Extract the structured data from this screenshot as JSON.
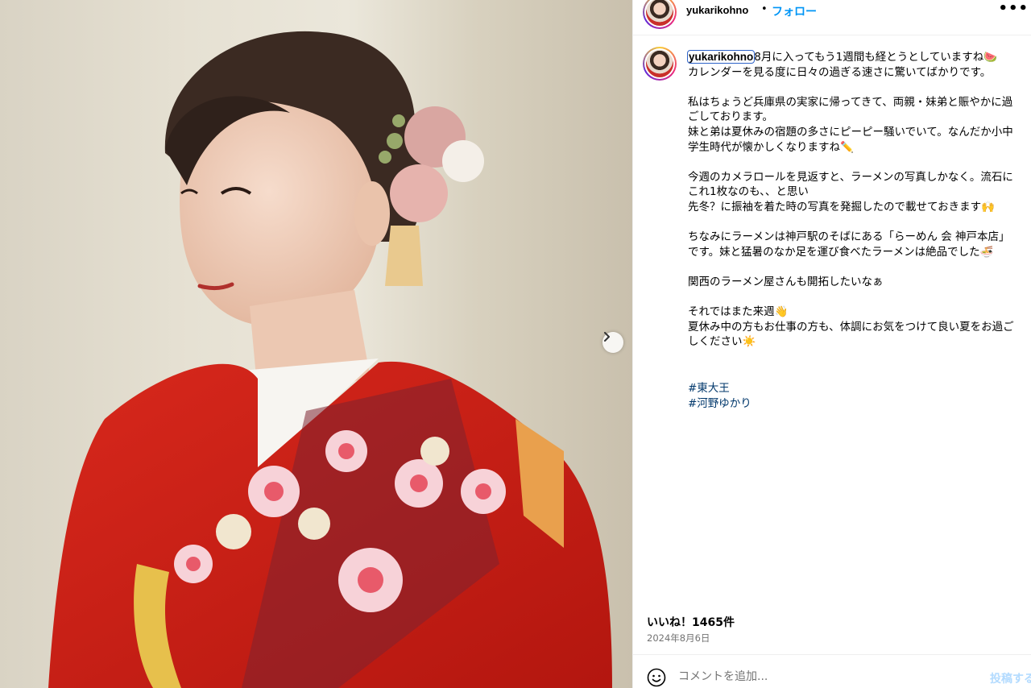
{
  "header": {
    "username": "yukarikohno",
    "separator": "•",
    "follow_label": "フォロー",
    "more_label": "•••"
  },
  "caption": {
    "username": "yukarikohno",
    "text": "8月に入ってもう1週間も経とうとしていますね🍉\nカレンダーを見る度に日々の過ぎる速さに驚いてばかりです。\n\n私はちょうど兵庫県の実家に帰ってきて、両親・妹弟と賑やかに過ごしております。\n妹と弟は夏休みの宿題の多さにピーピー騒いでいて。なんだか小中学生時代が懐かしくなりますね✏️\n\n今週のカメラロールを見返すと、ラーメンの写真しかなく。流石にこれ1枚なのも、、と思い\n先冬？に振袖を着た時の写真を発掘したので載せておきます🙌\n\nちなみにラーメンは神戸駅のそばにある「らーめん 会 神戸本店」です。妹と猛暑のなか足を運び食べたラーメンは絶品でした🍜\n\n関西のラーメン屋さんも開拓したいなぁ\n\nそれではまた来週👋\n夏休み中の方もお仕事の方も、体調にお気をつけて良い夏をお過ごしください☀️",
    "hashtags": [
      "#東大王",
      "#河野ゆかり"
    ]
  },
  "likes": "いいね！1465件",
  "date": "2024年8月6日",
  "comment": {
    "placeholder": "コメントを追加...",
    "post_label": "投稿する"
  },
  "icons": {
    "next": "chevron-right-icon",
    "emoji": "smiley-icon",
    "more": "more-horizontal-icon"
  },
  "colors": {
    "follow": "#0095f6",
    "hashtag": "#00376b",
    "post_disabled": "#b3dbff",
    "meta": "#737373"
  }
}
